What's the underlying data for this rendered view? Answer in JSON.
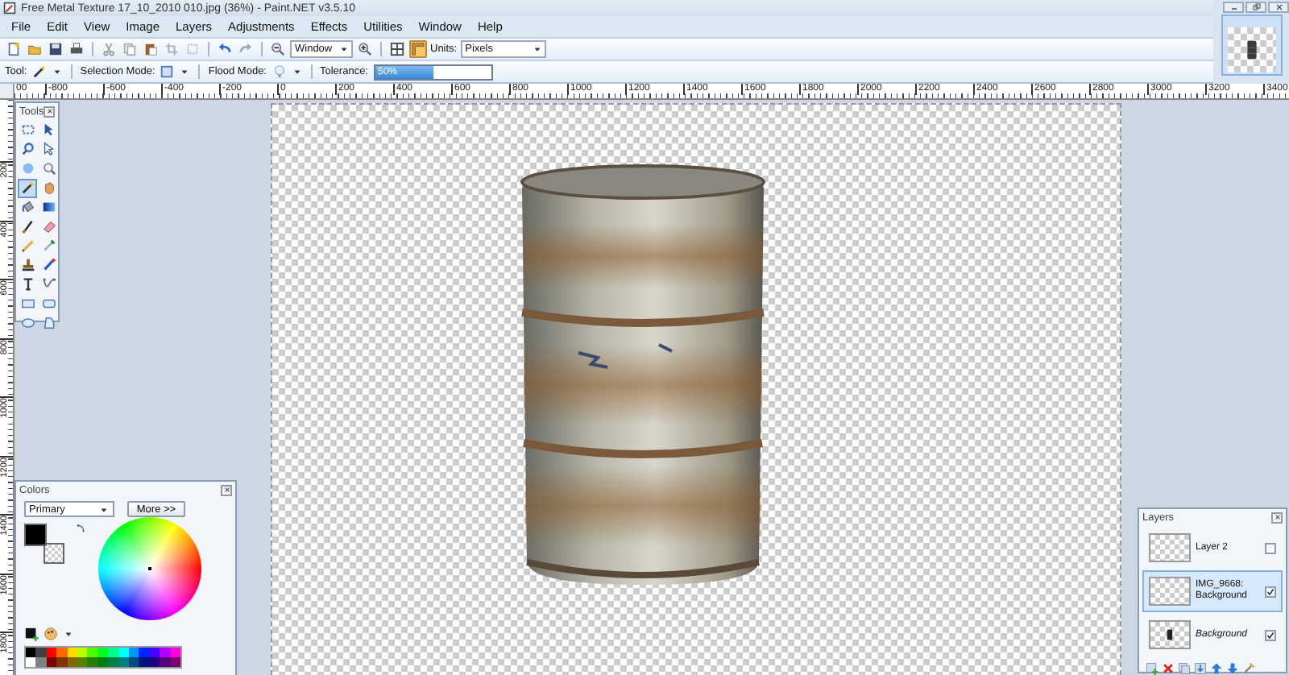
{
  "window": {
    "title": "Free Metal Texture 17_10_2010 010.jpg (36%) - Paint.NET v3.5.10"
  },
  "menu": [
    "File",
    "Edit",
    "View",
    "Image",
    "Layers",
    "Adjustments",
    "Effects",
    "Utilities",
    "Window",
    "Help"
  ],
  "toolbar": {
    "zoom_mode": "Window",
    "rulers_on": true,
    "units_label": "Units:",
    "units": "Pixels"
  },
  "tool_options": {
    "tool_label": "Tool:",
    "selection_mode_label": "Selection Mode:",
    "flood_mode_label": "Flood Mode:",
    "tolerance_label": "Tolerance:",
    "tolerance": {
      "level": 0.5,
      "reading": "50%"
    }
  },
  "rulers": {
    "horizontal": [
      "00",
      "-800",
      "-600",
      "-400",
      "-200",
      "0",
      "200",
      "400",
      "600",
      "800",
      "1000",
      "1200",
      "1400",
      "1600",
      "1800",
      "2000",
      "2200",
      "2400",
      "2600",
      "2800",
      "3000",
      "3200",
      "3400"
    ],
    "vertical": [
      "200",
      "400",
      "600",
      "800",
      "1000",
      "1200",
      "1400",
      "1600",
      "1800"
    ]
  },
  "tools_panel": {
    "title": "Tools",
    "tools": [
      {
        "selected": false
      },
      {
        "selected": false
      },
      {
        "selected": false
      },
      {
        "selected": false
      },
      {
        "selected": false
      },
      {
        "selected": false
      },
      {
        "selected": true
      },
      {
        "selected": false
      },
      {
        "selected": false
      },
      {
        "selected": false
      },
      {
        "selected": false
      },
      {
        "selected": false
      },
      {
        "selected": false
      },
      {
        "selected": false
      },
      {
        "selected": false
      },
      {
        "selected": false
      },
      {
        "selected": false
      },
      {
        "selected": false
      },
      {
        "selected": false
      },
      {
        "selected": false
      },
      {
        "selected": false
      },
      {
        "selected": false
      }
    ]
  },
  "colors_panel": {
    "title": "Colors",
    "mode": "Primary",
    "more_button": "More >>",
    "primary": {
      "color": "#000000"
    },
    "palette": [
      [
        {
          "color": "#000000"
        },
        {
          "color": "#404040"
        },
        {
          "color": "#ff0000"
        },
        {
          "color": "#ff6a00"
        },
        {
          "color": "#ffd800"
        },
        {
          "color": "#b6ff00"
        },
        {
          "color": "#4cff00"
        },
        {
          "color": "#00ff21"
        },
        {
          "color": "#00ff90"
        },
        {
          "color": "#00ffff"
        },
        {
          "color": "#0094ff"
        },
        {
          "color": "#0026ff"
        },
        {
          "color": "#4800ff"
        },
        {
          "color": "#b200ff"
        },
        {
          "color": "#ff00dc"
        }
      ],
      [
        {
          "color": "#ffffff"
        },
        {
          "color": "#808080"
        },
        {
          "color": "#7f0000"
        },
        {
          "color": "#7f3300"
        },
        {
          "color": "#7f6a00"
        },
        {
          "color": "#5b7f00"
        },
        {
          "color": "#267f00"
        },
        {
          "color": "#007f0e"
        },
        {
          "color": "#007f46"
        },
        {
          "color": "#007f7f"
        },
        {
          "color": "#004a7f"
        },
        {
          "color": "#00137f"
        },
        {
          "color": "#21007f"
        },
        {
          "color": "#57007f"
        },
        {
          "color": "#7f006e"
        }
      ]
    ]
  },
  "layers_panel": {
    "title": "Layers",
    "layers": [
      {
        "name": "Layer 2",
        "kind": "layer",
        "selected": false,
        "visible": false
      },
      {
        "name": "IMG_9668: Background",
        "kind": "layer",
        "selected": true,
        "visible": true
      },
      {
        "name": "Background",
        "kind": "background",
        "selected": false,
        "visible": true
      }
    ]
  }
}
